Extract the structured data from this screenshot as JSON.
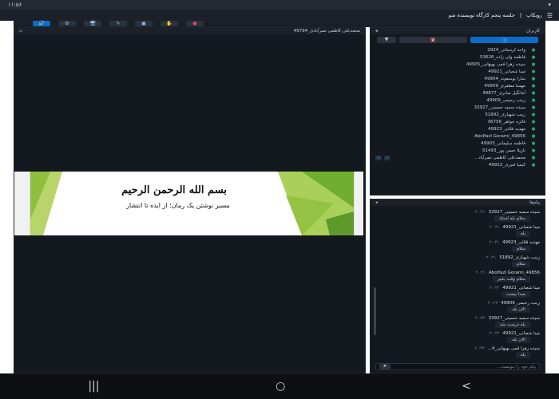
{
  "status": {
    "time": "۱۱:۵۶",
    "left_icons": "▾"
  },
  "appbar": {
    "app_name": "روبکاپ",
    "separator": "|",
    "title": "جلسه پنجم کارگاه نویسنده شو"
  },
  "toolbar": {
    "items": [
      "🔊",
      "⚙",
      "🖥",
      "✎",
      "▣",
      "✋",
      "●"
    ]
  },
  "presenter": {
    "name": "محمدعلی کاظمی نصرآبادی_49794"
  },
  "slide": {
    "title": "بسم الله الرحمن الرحیم",
    "subtitle": "مسیر نوشتن یک رمان؛ از ایده تا انتشار"
  },
  "users_panel": {
    "title": "کاربران",
    "tab_icons": [
      "👥",
      "🔇"
    ],
    "dropdown": "▼",
    "users": [
      "واحد لرستانی_2924",
      "فاطمه ولی زاده_53626",
      "سیده زهرا قمی بهبهانی_49905",
      "مینا شعبانی_49921",
      "سارا یوسفوند_49904",
      "مهسا مظفری_49909",
      "آمانگیل صابری_49877",
      "زینب رحیمی_49909",
      "سیده سمیه حسینی_33927",
      "زینب شهبازی_51892",
      "فائزه جواهر_36756",
      "مهدیه قلائی_49923",
      "Abolfazl Gorami_49856",
      "فاطمه سلیمانی_49903",
      "نازیلا حسن پور_51493",
      "محمدعلی کاظمی نصرآباد...",
      "کیمیا امیری_49922"
    ]
  },
  "messages_panel": {
    "title": "پیام‌ها",
    "messages": [
      {
        "sender": "سیده سمیه حسینی_33927",
        "time": "۲۰:۴۱",
        "text": "سلام بله استاد"
      },
      {
        "sender": "مینا شعبانی_49921",
        "time": "۲۰:۴۱",
        "text": "بله"
      },
      {
        "sender": "مهدیه قلائی_49923",
        "time": "۲۰:۴۱",
        "text": "سلام"
      },
      {
        "sender": "زینب شهبازی_51892",
        "time": "۲۰:۴۱",
        "text": "سلام"
      },
      {
        "sender": "Abolfazl Gorami_49856",
        "time": "۲۰:۴۱",
        "text": "سلام وقت بخیر"
      },
      {
        "sender": "مینا شعبانی_49921",
        "time": "۲۰:۴۲",
        "text": "صدا نیست"
      },
      {
        "sender": "زینب رحیمی_49909",
        "time": "۲۰:۴۲",
        "text": "الان بله"
      },
      {
        "sender": "سیده سمیه حسینی_33927",
        "time": "۲۰:۴۲",
        "text": "بله درست شد"
      },
      {
        "sender": "مینا شعبانی_49921",
        "time": "۲۰:۴۲",
        "text": "الان بله"
      },
      {
        "sender": "سیده زهرا قمی بهبهانی_4...",
        "time": "۲۰:۴۳",
        "text": "بله"
      }
    ],
    "input_placeholder": "پیام خود را بنویسید...",
    "send_label": "➤"
  },
  "navbar": {
    "recents": "|||",
    "home": "○",
    "back": "<"
  }
}
